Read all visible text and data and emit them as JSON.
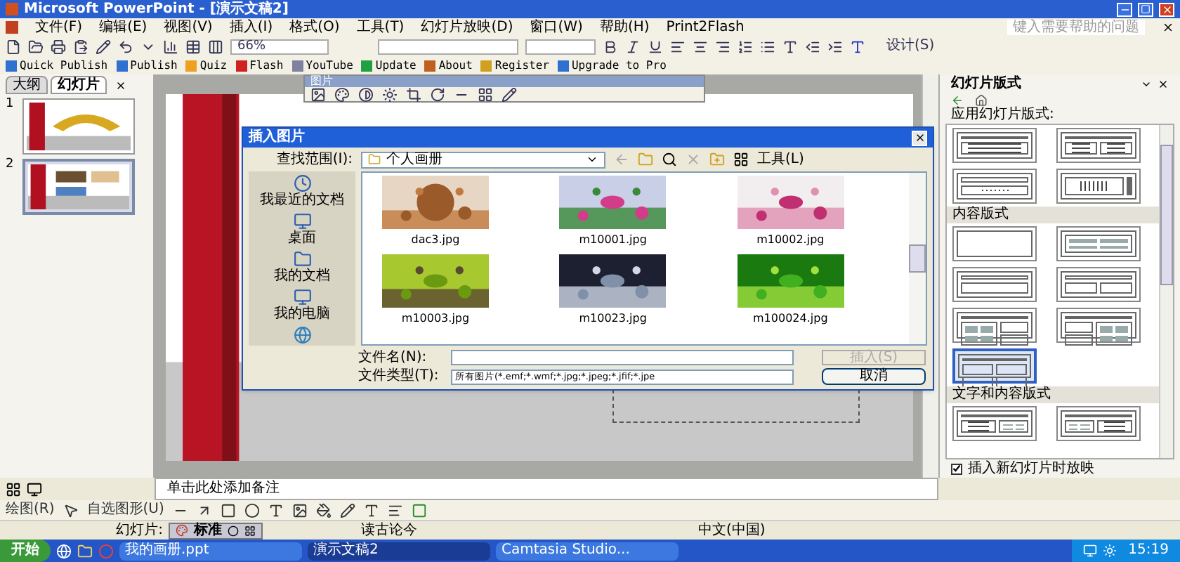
{
  "window": {
    "title": "Microsoft PowerPoint - [演示文稿2]"
  },
  "menu": [
    "文件(F)",
    "编辑(E)",
    "视图(V)",
    "插入(I)",
    "格式(O)",
    "工具(T)",
    "幻灯片放映(D)",
    "窗口(W)",
    "帮助(H)",
    "Print2Flash"
  ],
  "help_box": {
    "placeholder": "键入需要帮助的问题"
  },
  "toolbar": {
    "zoom": "66%",
    "design": "设计(S)"
  },
  "addin_toolbar": [
    "Quick Publish",
    "Publish",
    "Quiz",
    "Flash",
    "YouTube",
    "Update",
    "About",
    "Register",
    "Upgrade to Pro"
  ],
  "left_tabs": [
    {
      "label": "大纲",
      "selected": false
    },
    {
      "label": "幻灯片",
      "selected": true
    }
  ],
  "slides": [
    {
      "number": "1",
      "selected": false
    },
    {
      "number": "2",
      "selected": true
    }
  ],
  "picture_toolbar": {
    "title": "图片"
  },
  "dialog": {
    "title": "插入图片",
    "look_in_label": "查找范围(I):",
    "look_in": "个人画册",
    "tools": "工具(L)",
    "places": [
      "我最近的文档",
      "桌面",
      "我的文档",
      "我的电脑"
    ],
    "files": [
      {
        "name": "dac3.jpg"
      },
      {
        "name": "m10001.jpg"
      },
      {
        "name": "m10002.jpg"
      },
      {
        "name": "m10003.jpg"
      },
      {
        "name": "m10023.jpg"
      },
      {
        "name": "m100024.jpg"
      }
    ],
    "file_name_label": "文件名(N):",
    "file_type_label": "文件类型(T):",
    "file_type": "所有图片(*.emf;*.wmf;*.jpg;*.jpeg;*.jfif;*.jpe",
    "insert": "插入(S)",
    "cancel": "取消"
  },
  "notes": {
    "placeholder": "单击此处添加备注"
  },
  "drawing_toolbar": {
    "draw": "绘图(R)",
    "autoshapes": "自选图形(U)"
  },
  "status_bar": {
    "slide": "幻灯片:",
    "ime": "标准",
    "design": "读古论今",
    "language": "中文(中国)"
  },
  "task_pane": {
    "title": "幻灯片版式",
    "apply_label": "应用幻灯片版式:",
    "sections": [
      {
        "layouts": [
          {
            "kind": "title_text",
            "selected": false
          },
          {
            "kind": "title_two_text",
            "selected": false
          },
          {
            "kind": "vertical_text",
            "selected": false
          },
          {
            "kind": "vertical_title",
            "selected": false
          }
        ]
      },
      {
        "title": "内容版式",
        "layouts": [
          {
            "kind": "blank",
            "selected": false
          },
          {
            "kind": "content",
            "selected": false
          },
          {
            "kind": "title_content",
            "selected": false
          },
          {
            "kind": "title_two_content",
            "selected": false
          },
          {
            "kind": "title_content_two",
            "selected": false
          },
          {
            "kind": "title_two_content_stack",
            "selected": false
          },
          {
            "kind": "title_four_content",
            "selected": true
          }
        ]
      },
      {
        "title": "文字和内容版式",
        "layouts": [
          {
            "kind": "title_text_content",
            "selected": false
          },
          {
            "kind": "title_content_text",
            "selected": false
          }
        ]
      }
    ],
    "show_on_insert": {
      "label": "插入新幻灯片时放映",
      "checked": true
    }
  },
  "taskbar": {
    "start": "开始",
    "tasks": [
      {
        "label": "我的画册.ppt",
        "selected": false
      },
      {
        "label": "演示文稿2",
        "selected": true
      },
      {
        "label": "Camtasia Studio...",
        "selected": false
      }
    ],
    "clock": "15:19"
  }
}
